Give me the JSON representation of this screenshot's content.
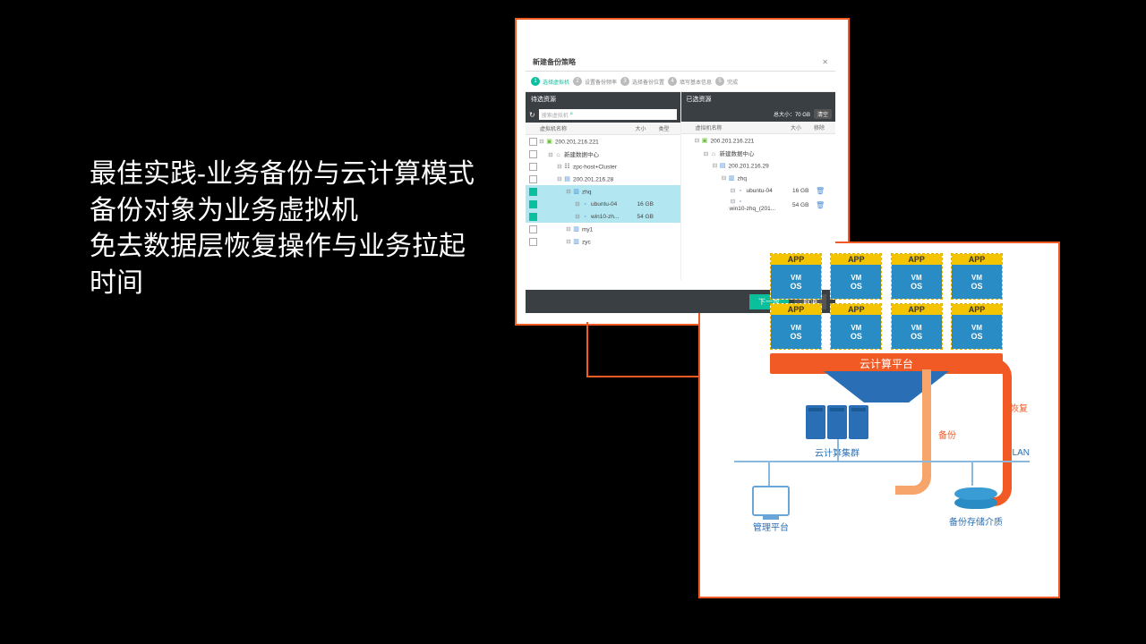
{
  "title": {
    "line1": "最佳实践-业务备份与云计算模式",
    "line2": "备份对象为业务虚拟机",
    "line3": "免去数据层恢复操作与业务拉起时间"
  },
  "dialog": {
    "title": "新建备份策略",
    "steps": [
      "选择虚拟机",
      "设置备份频率",
      "选择备份位置",
      "填写基本信息",
      "完成"
    ],
    "left": {
      "header": "待选资源",
      "search_placeholder": "搜索虚拟机",
      "cols": {
        "name": "虚拟机名称",
        "size": "大小",
        "type": "类型"
      },
      "tree": [
        {
          "type": "vc",
          "label": "200.201.216.221",
          "chk": false
        },
        {
          "type": "dc",
          "label": "新建数据中心",
          "indent": 1,
          "chk": false
        },
        {
          "type": "cluster",
          "label": "zpc-host+Cluster",
          "indent": 2,
          "chk": false
        },
        {
          "type": "host",
          "label": "200.201.216.28",
          "indent": 2,
          "chk": false
        },
        {
          "type": "folder",
          "label": "zhq",
          "indent": 3,
          "chk": true,
          "sel": true
        },
        {
          "type": "vm",
          "label": "ubuntu-04",
          "size": "16 GB",
          "indent": 4,
          "chk": true,
          "sel": true
        },
        {
          "type": "vm",
          "label": "win10-zh...",
          "size": "54 GB",
          "indent": 4,
          "chk": true,
          "sel": true
        },
        {
          "type": "folder",
          "label": "my1",
          "indent": 3,
          "chk": false
        },
        {
          "type": "folder",
          "label": "zyc",
          "indent": 3,
          "chk": false
        }
      ]
    },
    "right": {
      "header": "已选资源",
      "total_label": "总大小：",
      "total_value": "70 GB",
      "clear": "清空",
      "cols": {
        "name": "虚拟机名称",
        "size": "大小",
        "del": "移除"
      },
      "tree": [
        {
          "type": "vc",
          "label": "200.201.216.221"
        },
        {
          "type": "dc",
          "label": "新建数据中心",
          "indent": 1
        },
        {
          "type": "host",
          "label": "200.201.216.29",
          "indent": 2
        },
        {
          "type": "folder",
          "label": "zhq",
          "indent": 3
        },
        {
          "type": "vm",
          "label": "ubuntu-04",
          "size": "16 GB",
          "indent": 4,
          "del": true
        },
        {
          "type": "vm",
          "label": "win10-zhq_(201...",
          "size": "54 GB",
          "indent": 4,
          "del": true
        }
      ]
    },
    "footer": {
      "next": "下一步",
      "cancel": "取消"
    }
  },
  "diagram": {
    "vm": {
      "app": "APP",
      "vm": "VM",
      "os": "OS"
    },
    "platform": "云计算平台",
    "cluster": "云计算集群",
    "lan": "LAN",
    "mgmt": "管理平台",
    "storage": "备份存储介质",
    "backup": "备份",
    "restore": "恢复"
  }
}
